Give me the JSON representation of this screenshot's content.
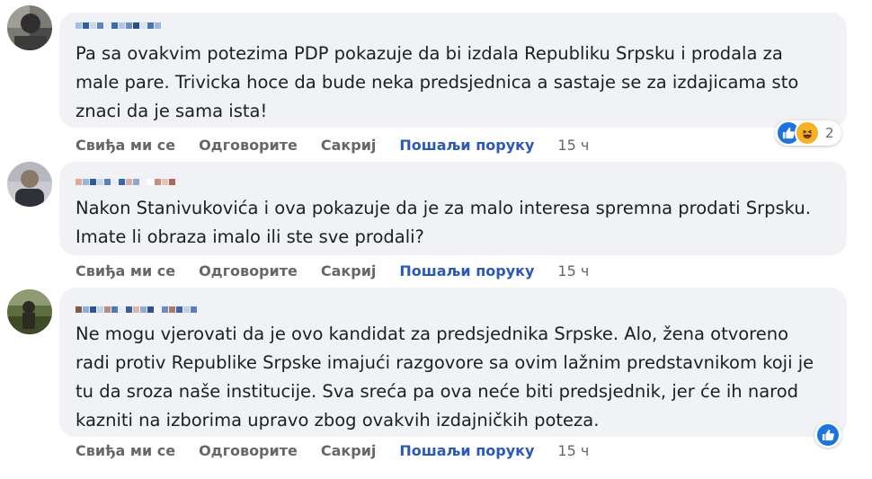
{
  "colors": {
    "bubble": "#f0f2f5",
    "link": "#2a5ab8",
    "meta": "#65676b",
    "like": "#1b74e4",
    "haha": "#f7b125"
  },
  "comments": [
    {
      "author": "",
      "text": "Pa sa ovakvim potezima PDP pokazuje da bi izdala Republiku Srpsku i prodala za\nmale pare. Trivicka hoce da bude neka predsjednica a sastaje se za izdajicama sto\nznaci da je sama ista!",
      "actions": {
        "like": "Свиђа ми се",
        "reply": "Одговорите",
        "hide": "Сакриј",
        "message": "Пошаљи поруку",
        "time": "15 ч"
      },
      "reactions": {
        "icons": [
          "like-icon",
          "haha-icon"
        ],
        "count": "2"
      }
    },
    {
      "author": "",
      "text": "Nakon Stanivukovića i ova pokazuje da je za malo interesa spremna prodati Srpsku.\nImate li obraza imalo ili ste sve prodali?",
      "actions": {
        "like": "Свиђа ми се",
        "reply": "Одговорите",
        "hide": "Сакриј",
        "message": "Пошаљи поруку",
        "time": "15 ч"
      }
    },
    {
      "author": "",
      "text": "Ne mogu vjerovati da je ovo kandidat za predsjednika Srpske. Alo, žena otvoreno\nradi protiv Republike Srpske imajući razgovore sa ovim lažnim predstavnikom koji je\ntu da sroza naše institucije. Sva sreća pa ova neće biti predsjednik, jer će ih narod\nkazniti na izborima upravo zbog ovakvih izdajničkih poteza.",
      "actions": {
        "like": "Свиђа ми се",
        "reply": "Одговорите",
        "hide": "Сакриј",
        "message": "Пошаљи поруку",
        "time": "15 ч"
      },
      "reactions": {
        "icons": [
          "like-icon"
        ]
      }
    }
  ]
}
